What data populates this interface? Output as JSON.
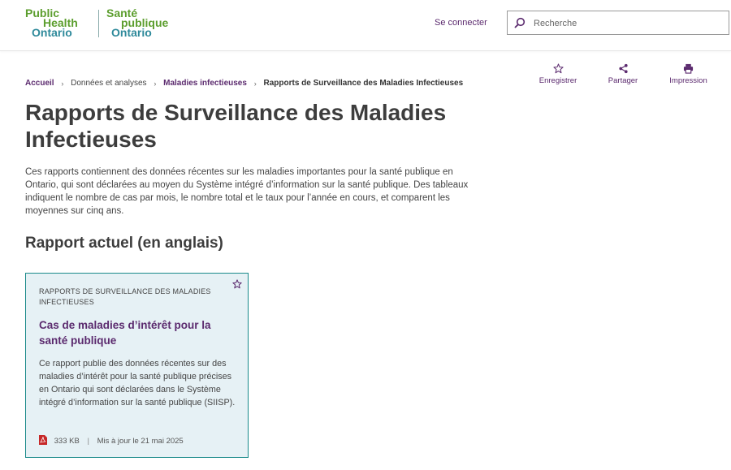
{
  "header": {
    "logo_en": {
      "line1": "Public",
      "line2": "Health",
      "line3": "Ontario"
    },
    "logo_fr": {
      "line1": "Santé",
      "line2": "publique",
      "line3": "Ontario"
    },
    "login_label": "Se connecter",
    "search_placeholder": "Recherche",
    "search_icon": "search-icon"
  },
  "breadcrumb": {
    "items": [
      "Accueil",
      "Données et analyses",
      "Maladies infectieuses",
      "Rapports de Surveillance des Maladies Infectieuses"
    ],
    "separator": "›"
  },
  "actions": {
    "save_label": "Enregistrer",
    "share_label": "Partager",
    "print_label": "Impression"
  },
  "page": {
    "title": "Rapports de Surveillance des Maladies Infectieuses",
    "intro": "Ces rapports contiennent des données récentes sur les maladies importantes pour la santé publique en Ontario, qui sont déclarées au moyen du Système intégré d’information sur la santé publique. Des tableaux indiquent le nombre de cas par mois, le nombre total et le taux pour l’année en cours, et comparent les moyennes sur cinq ans.",
    "section_title": "Rapport actuel (en anglais)"
  },
  "card": {
    "category": "RAPPORTS DE SURVEILLANCE DES MALADIES INFECTIEUSES",
    "title": "Cas de maladies d’intérêt pour la santé publique",
    "description": "Ce rapport publie des données récentes sur des maladies d’intérêt pour la santé publique précises en Ontario qui sont déclarées dans le Système intégré d’information sur la santé publique (SIISP).",
    "file_size": "333 KB",
    "updated": "Mis à jour le 21 mai 2025"
  },
  "colors": {
    "brand_purple": "#5b2a6e",
    "logo_green": "#5c9e2e",
    "logo_teal": "#2f8a9b",
    "card_bg": "#e6f1f5",
    "card_border": "#1a8a8a"
  }
}
